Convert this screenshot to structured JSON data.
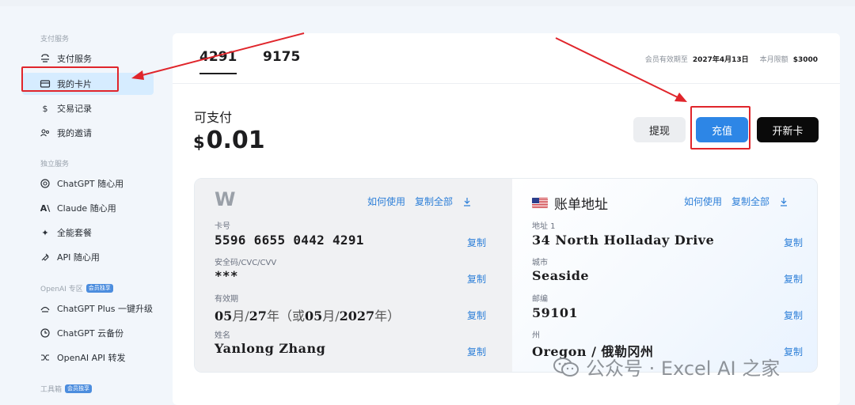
{
  "sidebar": {
    "sections": [
      {
        "title": "支付服务",
        "badge": ""
      },
      {
        "title": "独立服务",
        "badge": ""
      },
      {
        "title": "OpenAI 专区",
        "badge": "会员独享"
      },
      {
        "title": "工具箱",
        "badge": "会员独享"
      }
    ],
    "items": [
      {
        "label": "支付服务",
        "icon": "payment-icon"
      },
      {
        "label": "我的卡片",
        "icon": "card-icon"
      },
      {
        "label": "交易记录",
        "icon": "dollar-icon"
      },
      {
        "label": "我的邀请",
        "icon": "users-icon"
      },
      {
        "label": "ChatGPT 随心用",
        "icon": "openai-icon"
      },
      {
        "label": "Claude 随心用",
        "icon": "anthropic-icon"
      },
      {
        "label": "全能套餐",
        "icon": "sparkle-icon"
      },
      {
        "label": "API 随心用",
        "icon": "plug-icon"
      },
      {
        "label": "ChatGPT Plus 一键升级",
        "icon": "upgrade-icon"
      },
      {
        "label": "ChatGPT 云备份",
        "icon": "clock-icon"
      },
      {
        "label": "OpenAI API 转发",
        "icon": "shuffle-icon"
      }
    ]
  },
  "tabs": [
    {
      "label": "4291"
    },
    {
      "label": "9175"
    }
  ],
  "meta": {
    "expiry_label": "会员有效期至",
    "expiry_value": "2027年4月13日",
    "limit_label": "本月限额",
    "limit_value": "$3000"
  },
  "balance": {
    "label": "可支付",
    "currency": "$",
    "amount": "0.01"
  },
  "buttons": {
    "withdraw": "提现",
    "topup": "充值",
    "new_card": "开新卡"
  },
  "card": {
    "brand": "W",
    "how_to_use": "如何使用",
    "copy_all": "复制全部",
    "copy": "复制",
    "number_label": "卡号",
    "number": "5596 6655 0442 4291",
    "cvv_label": "安全码/CVC/CVV",
    "cvv": "***",
    "expiry_label": "有效期",
    "exp_month": "05",
    "exp_month_unit": "月/",
    "exp_day": "27",
    "exp_year_unit": "年（或",
    "exp_month2": "05",
    "exp_month2_unit": "月/",
    "exp_year": "2027",
    "exp_close": "年）",
    "name_label": "姓名",
    "name": "Yanlong Zhang"
  },
  "billing": {
    "title": "账单地址",
    "how_to_use": "如何使用",
    "copy_all": "复制全部",
    "copy": "复制",
    "address_label": "地址 1",
    "address": "34 North Holladay Drive",
    "city_label": "城市",
    "city": "Seaside",
    "zip_label": "邮编",
    "zip": "59101",
    "state_label": "州",
    "state": "Oregon / 俄勒冈州"
  },
  "watermark": "公众号 · Excel AI 之家",
  "colors": {
    "accent": "#2d86e6",
    "annotation_red": "#e0252b",
    "active_nav": "#d6ecff"
  }
}
